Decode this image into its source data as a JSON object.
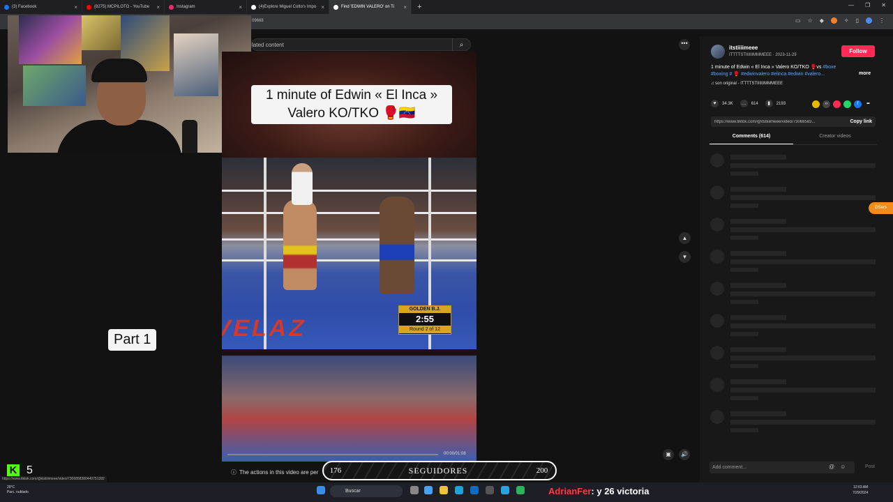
{
  "browser": {
    "tabs": [
      {
        "label": "(3) Facebook",
        "color": "#1877f2",
        "active": false
      },
      {
        "label": "(8275) MCPILOTO - YouTube",
        "color": "#ff0000",
        "active": false
      },
      {
        "label": "Instagram",
        "color": "#e1306c",
        "active": false
      },
      {
        "label": "(4)Explore Miguel Cotto's Impo",
        "color": "#ffffff",
        "active": false
      },
      {
        "label": "Find 'EDWIN VALERO' on Ti",
        "color": "#ffffff",
        "active": true
      }
    ],
    "new_tab": "+",
    "address_partial": "09668"
  },
  "search": {
    "label": "lated content",
    "icon": "search-icon"
  },
  "video": {
    "title_line1": "1 minute of Edwin « El Inca »",
    "title_line2": "Valero KO/TKO 🥊🇻🇪",
    "scoreboard_top": "GOLDEN B.J.",
    "scoreboard_time": "2:55",
    "scoreboard_round": "Round 2 of 12",
    "mat_text": "VELAZ",
    "part_label": "Part 1",
    "time": "00:00/01:08"
  },
  "post": {
    "username": "itstiiiimeee",
    "handle_date": "ITTTTSTIIIIIIMMMEEE · 2023-11-29",
    "follow": "Follow",
    "desc_text": "1 minute of Edwin « El Inca » Valero KO/TKO 🥊vs ",
    "desc_tags": "#boxe #boxing # 🥊 #edwinvalero #elinca #edwin #valero...",
    "more": "more",
    "sound": "son original - ITTTTSTIIIIIIMMMEEE",
    "likes": "34.3K",
    "comments": "614",
    "saves": "2193",
    "link": "https://www.tiktok.com/@itstiiiimeee/video/73068583...",
    "copy_link": "Copy link",
    "tab_comments": "Comments (614)",
    "tab_creator": "Creator videos",
    "add_comment_placeholder": "Add comment...",
    "post_btn": "Post"
  },
  "ext_badge": "DSers",
  "overlay": {
    "actions_note": "The actions in this video are per",
    "followers_current": "176",
    "followers_label": "SEGUIDORES",
    "followers_goal": "200",
    "kick_count": "5",
    "chat_user": "AdrianFer",
    "chat_text": ": y 26 victoria"
  },
  "status_url": "https://www.tiktok.com/@itstiiiimeee/video/7306858380440751392",
  "taskbar": {
    "weather_temp": "29°C",
    "weather_desc": "Parc. nublado",
    "search": "Buscar",
    "time": "12:03 AM",
    "date": "7/29/2024"
  }
}
